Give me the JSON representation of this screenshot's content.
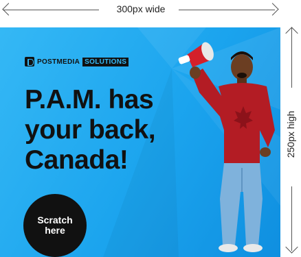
{
  "annotations": {
    "width_label": "300px wide",
    "height_label": "250px high"
  },
  "ad": {
    "brand": "POSTMEDIA",
    "brand_box": "SOLUTIONS",
    "headline_lines": [
      "P.A.M. has",
      "your back,",
      "Canada!"
    ],
    "cta_line1": "Scratch",
    "cta_line2": "here",
    "colors": {
      "background": "#1ba4ee",
      "text": "#111111",
      "cta_bg": "#111111",
      "sweater": "#b31c24",
      "jeans": "#7fb2dc",
      "megaphone": "#d4202a"
    },
    "icons": [
      "postmedia-logo-icon",
      "megaphone-icon",
      "maple-leaf-icon"
    ]
  }
}
